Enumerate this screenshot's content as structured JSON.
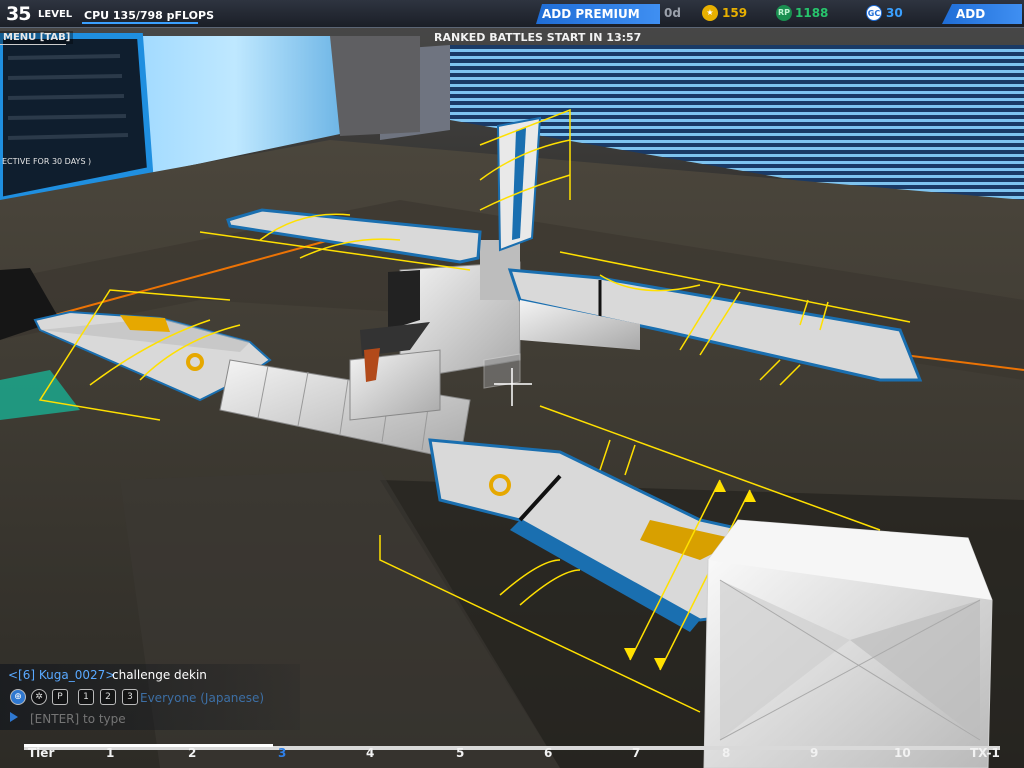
{
  "header": {
    "level_number": "35",
    "level_label": "LEVEL",
    "cpu_text": "CPU 135/798 pFLOPS",
    "add_premium_label": "ADD PREMIUM",
    "premium_days": "0d",
    "robits": "159",
    "rp_label": "RP",
    "rp_value": "1188",
    "gc_label": "GC",
    "gc_value": "30",
    "add_funds_label": "ADD FUNDS",
    "menu_label": "MENU [TAB]",
    "ranked_notice": "RANKED BATTLES START IN 13:57"
  },
  "screen": {
    "panel_text": "ECTIVE FOR 30 DAYS )"
  },
  "chat": {
    "user": "<[6] Kuga_0027>",
    "message": "challenge dekin",
    "channel": "Everyone (Japanese)",
    "placeholder": "[ENTER] to type",
    "icons": [
      "globe-icon",
      "people-icon",
      "party-icon",
      "player-1-icon",
      "player-2-icon",
      "player-3-icon"
    ],
    "icon_glyphs": [
      "⊕",
      "✲",
      "P",
      "1",
      "2",
      "3"
    ]
  },
  "tiers": {
    "labels": [
      "Tier",
      "1",
      "2",
      "3",
      "4",
      "5",
      "6",
      "7",
      "8",
      "9",
      "10",
      "TX-1"
    ],
    "progress_fraction": 0.255,
    "active_index": 3
  },
  "colors": {
    "accent_blue": "#2f80e8",
    "thruster_yellow": "#ffe000",
    "rp_green": "#27c46c",
    "robits_gold": "#e8b000",
    "gc_blue": "#3aa0ff",
    "floor_orange": "#ff7a00"
  }
}
